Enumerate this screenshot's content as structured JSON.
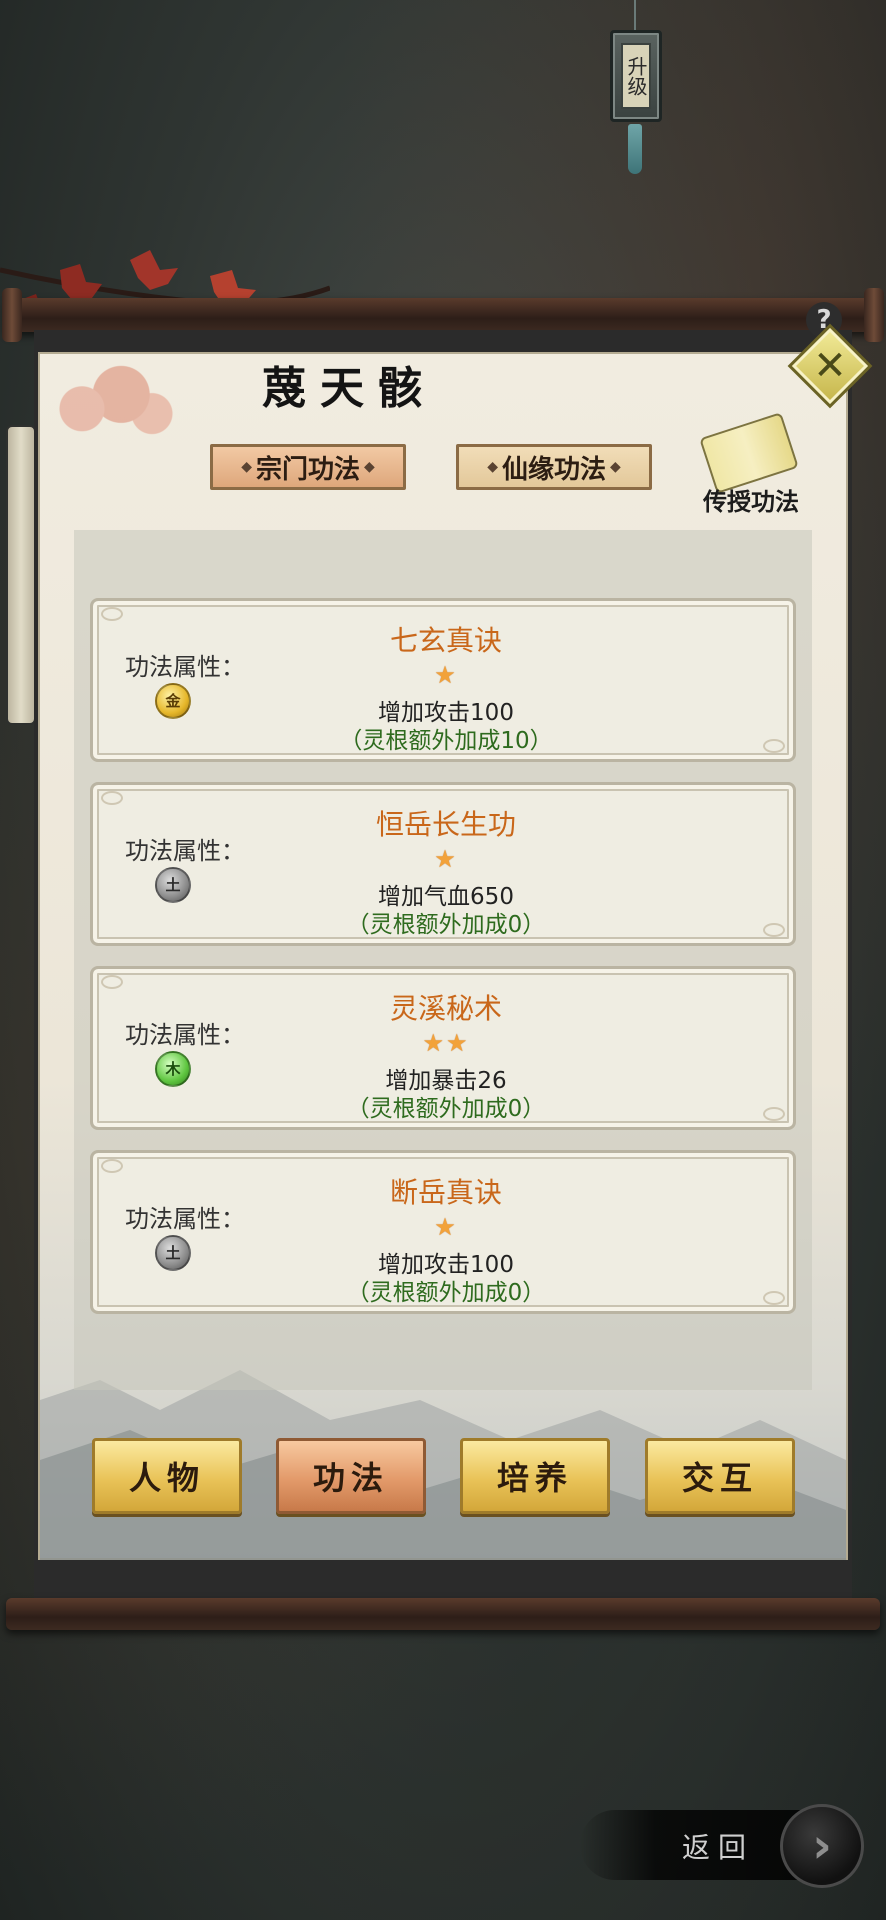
{
  "upgrade": {
    "label": "升级"
  },
  "character": {
    "name": "蔑天骸"
  },
  "help": {
    "label": "?"
  },
  "close": {
    "label": "✕"
  },
  "tabs": [
    {
      "label": "宗门功法",
      "active": true
    },
    {
      "label": "仙缘功法",
      "active": false
    }
  ],
  "teach": {
    "label": "传授功法"
  },
  "skills": [
    {
      "attr_label": "功法属性：",
      "element": "金",
      "element_type": "gold",
      "name": "七玄真诀",
      "stars": "★",
      "effect": "增加攻击100",
      "bonus": "（灵根额外加成10）"
    },
    {
      "attr_label": "功法属性：",
      "element": "土",
      "element_type": "earth",
      "name": "恒岳长生功",
      "stars": "★",
      "effect": "增加气血650",
      "bonus": "（灵根额外加成0）"
    },
    {
      "attr_label": "功法属性：",
      "element": "木",
      "element_type": "wood",
      "name": "灵溪秘术",
      "stars": "★★",
      "effect": "增加暴击26",
      "bonus": "（灵根额外加成0）"
    },
    {
      "attr_label": "功法属性：",
      "element": "土",
      "element_type": "earth",
      "name": "断岳真诀",
      "stars": "★",
      "effect": "增加攻击100",
      "bonus": "（灵根额外加成0）"
    }
  ],
  "nav": [
    {
      "label": "人物",
      "active": false
    },
    {
      "label": "功法",
      "active": true
    },
    {
      "label": "培养",
      "active": false
    },
    {
      "label": "交互",
      "active": false
    }
  ],
  "back": {
    "label": "返回",
    "arrow": "›"
  },
  "colors": {
    "title_orange": "#c9671a",
    "bonus_green": "#2e6b1e",
    "star": "#f2a23a"
  }
}
